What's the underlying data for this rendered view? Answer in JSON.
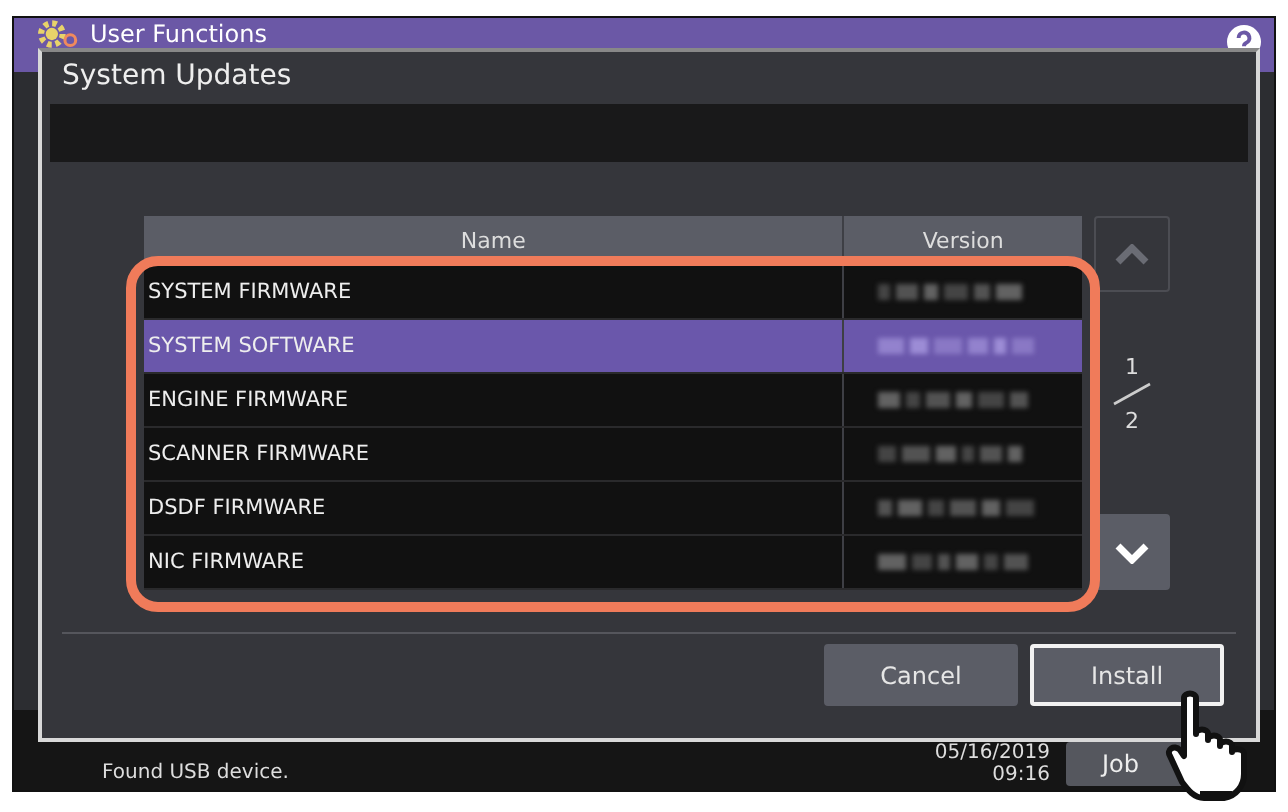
{
  "app": {
    "title": "User Functions"
  },
  "dialog": {
    "title": "System Updates",
    "table": {
      "columns": [
        "Name",
        "Version"
      ],
      "rows": [
        {
          "name": "SYSTEM FIRMWARE",
          "selected": false
        },
        {
          "name": "SYSTEM SOFTWARE",
          "selected": true
        },
        {
          "name": "ENGINE FIRMWARE",
          "selected": false
        },
        {
          "name": "SCANNER FIRMWARE",
          "selected": false
        },
        {
          "name": "DSDF FIRMWARE",
          "selected": false
        },
        {
          "name": "NIC FIRMWARE",
          "selected": false
        }
      ]
    },
    "page": {
      "current": "1",
      "total": "2"
    },
    "buttons": [
      {
        "label": "Cancel",
        "focused": false
      },
      {
        "label": "Install",
        "focused": true
      }
    ]
  },
  "status_bar": {
    "message": "Found USB device.",
    "date": "05/16/2019",
    "time": "09:16",
    "job_button": "Job"
  }
}
